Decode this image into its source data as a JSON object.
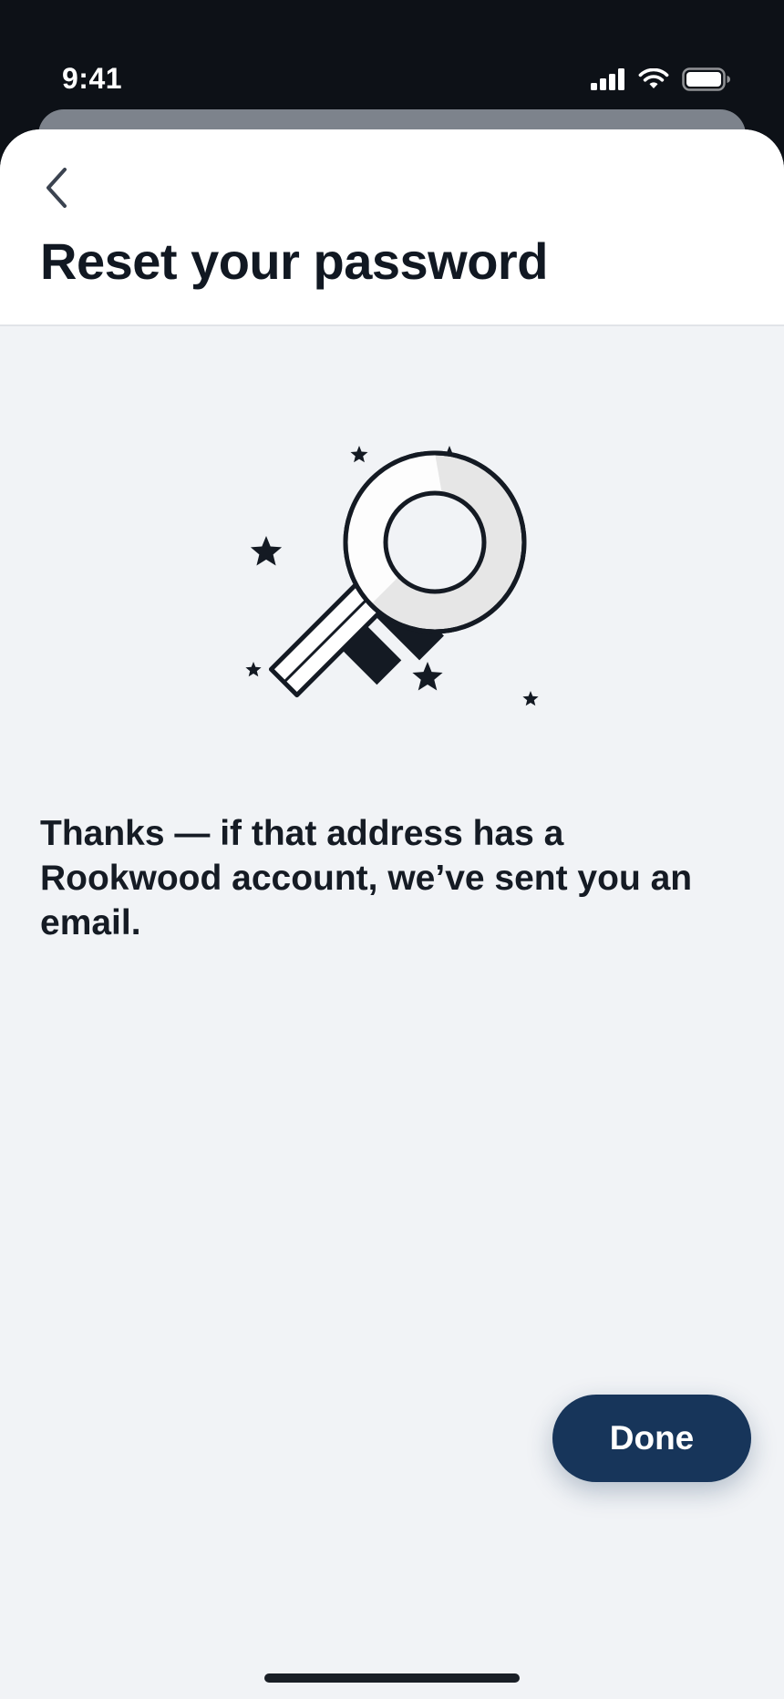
{
  "status_bar": {
    "time": "9:41",
    "icons": [
      "cellular-signal-icon",
      "wifi-icon",
      "battery-icon"
    ]
  },
  "header": {
    "back_icon": "chevron-left-icon",
    "title": "Reset your password"
  },
  "illustration": {
    "icon": "key-with-stars-illustration"
  },
  "message": {
    "text": "Thanks — if that address has a Rookwood account, we’ve sent you an email."
  },
  "actions": {
    "done_label": "Done"
  },
  "colors": {
    "status_bar_bg": "#0d1117",
    "sheet_bg": "#f1f3f6",
    "header_bg": "#ffffff",
    "title_text": "#111822",
    "primary_button": "#17355a",
    "primary_button_text": "#ffffff"
  }
}
